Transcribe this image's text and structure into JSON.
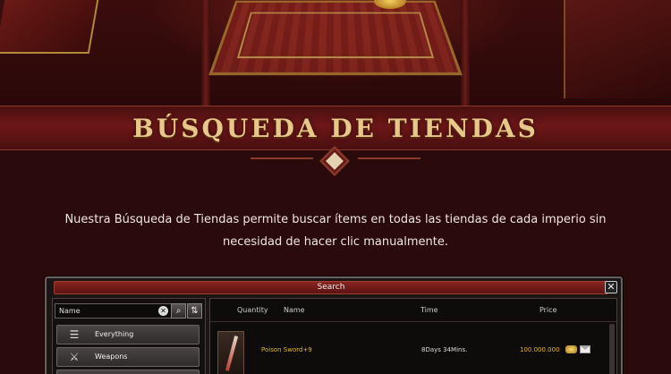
{
  "banner": {
    "title": "BÚSQUEDA DE TIENDAS"
  },
  "description": {
    "line1": "Nuestra Búsqueda de Tiendas permite buscar ítems en todas las tiendas de cada imperio sin",
    "line2": "necesidad de hacer clic manualmente."
  },
  "search_window": {
    "title": "Search",
    "close_glyph": "✕",
    "search_input": {
      "value": "Name",
      "placeholder": "Name"
    },
    "categories": [
      {
        "label": "Everything",
        "icon": "list-icon"
      },
      {
        "label": "Weapons",
        "icon": "sword-icon"
      }
    ],
    "columns": {
      "quantity": "Quantity",
      "name": "Name",
      "time": "Time",
      "price": "Price"
    },
    "rows": [
      {
        "name": "Poison Sword+9",
        "time": "8Days 34Mins.",
        "price": "100.000.000",
        "icon": "poison-sword-icon"
      }
    ],
    "colors": {
      "item_name": "#e8b820",
      "price": "#e8b820",
      "accent": "#8a2420"
    }
  }
}
